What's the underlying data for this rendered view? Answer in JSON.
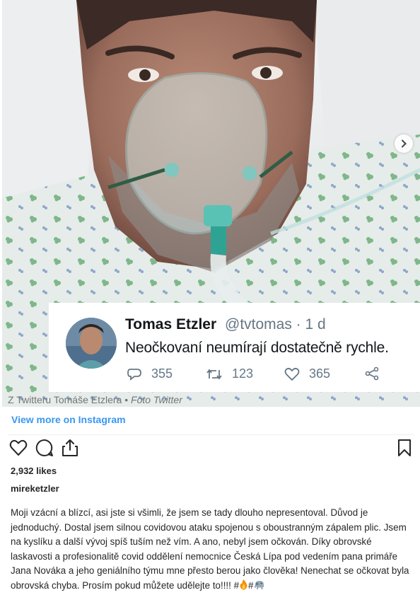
{
  "tweet": {
    "name": "Tomas Etzler",
    "handle": "@tvtomas · 1 d",
    "text": "Neočkovaní neumírají dostatečně rychle.",
    "replies": "355",
    "retweets": "123",
    "likes": "365"
  },
  "photo_caption": {
    "source": "Z Twitteru Tomáše Etzlera • ",
    "credit": "Foto Twitter"
  },
  "view_more": "View more on Instagram",
  "post": {
    "likes": "2,932 likes",
    "username": "mireketzler",
    "text": "Moji vzácní a blízcí, asi jste si všimli, že jsem se tady dlouho nepresentoval. Důvod je jednoduchý. Dostal jsem silnou covidovou ataku spojenou s oboustranným zápalem plic. Jsem na kyslíku a další vývoj spíš tuším než vím. A ano, nebyl jsem očkován. Díky obrovské laskavosti a profesionalitě covid oddělení nemocnice Česká Lípa pod vedením pana primáře Jana Nováka a jeho geniálního týmu mne přesto berou jako člověka! Nenechat se očkovat byla obrovská chyba. Prosím pokud můžete udělejte to!!!! #",
    "text_mid": "#"
  },
  "icons": {
    "heart": "heart-icon",
    "comment": "comment-icon",
    "share": "share-icon",
    "bookmark": "bookmark-icon",
    "next": "chevron-right-icon",
    "fire": "fire-emoji",
    "elephant": "elephant-emoji"
  },
  "colors": {
    "link": "#3897f0",
    "text": "#262626",
    "twitter_gray": "#657786"
  }
}
